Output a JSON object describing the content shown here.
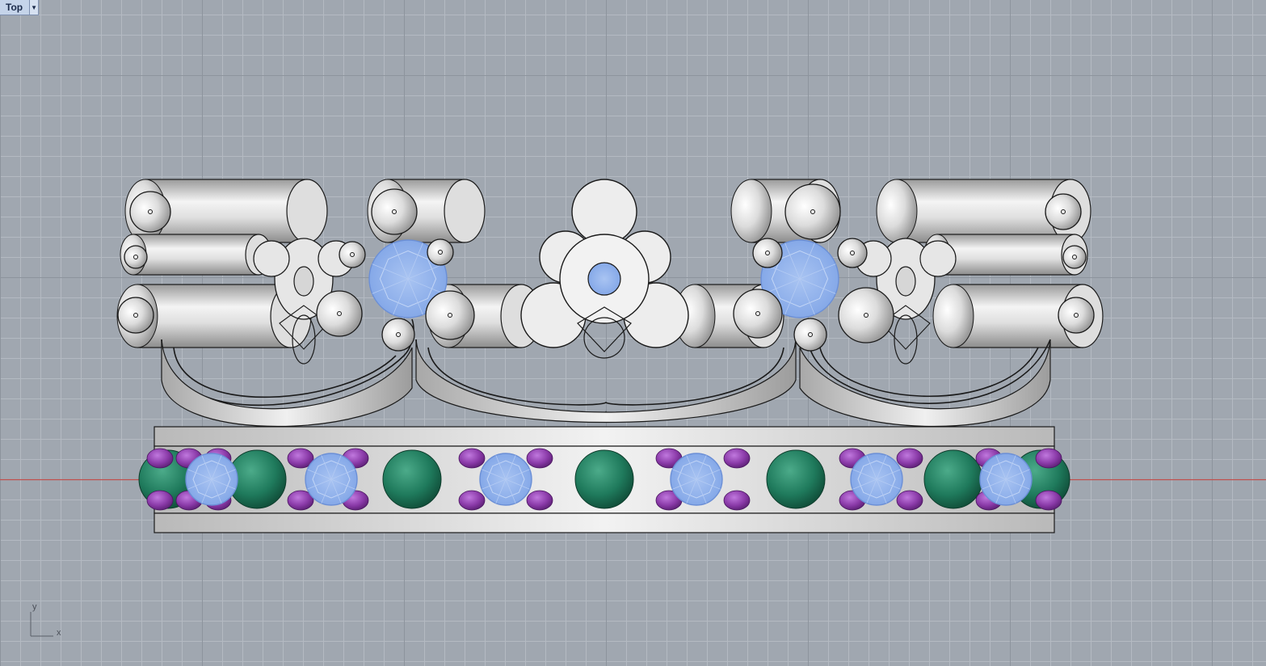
{
  "viewport": {
    "name": "Top",
    "dropdown_icon": "triangle-down-icon"
  },
  "axes": {
    "x_label": "x",
    "y_label": "y"
  },
  "colors": {
    "background": "#a0a7b0",
    "grid_minor": "#b4bac2",
    "grid_major": "#8d949d",
    "x_axis": "#c0504d",
    "metal": "#d9d9d9",
    "blue_gem": "#8fb1ee",
    "green_gem": "#1f7a5c",
    "purple_bead": "#8a3aa8"
  }
}
